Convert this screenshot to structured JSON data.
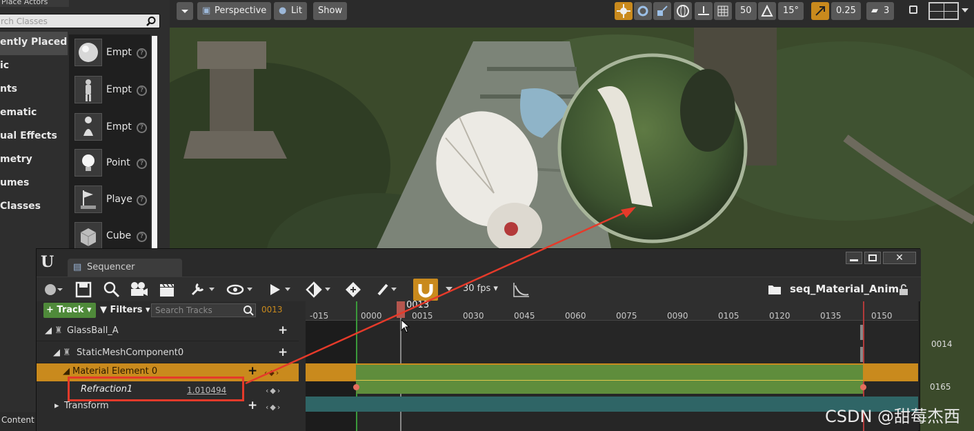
{
  "place_actors": {
    "title": "Place Actors",
    "search_placeholder": "rch Classes",
    "categories": [
      "ently Placed",
      "ic",
      "nts",
      "ematic",
      "ual Effects",
      "metry",
      "umes",
      "Classes"
    ],
    "items": [
      "Empt",
      "Empt",
      "Empt",
      "Point",
      "Playe",
      "Cube"
    ],
    "content_tab": "Content"
  },
  "viewport_toolbar": {
    "perspective": "Perspective",
    "lit": "Lit",
    "show": "Show",
    "grid_snap": "50",
    "rotate_snap": "15°",
    "scale_snap": "0.25",
    "camera_speed": "3"
  },
  "sequencer": {
    "tab_title": "Sequencer",
    "framerate": "30 fps",
    "sequence_name": "seq_Material_Anim",
    "add_track": "Track",
    "filters": "Filters",
    "search_placeholder": "Search Tracks",
    "current_frame": "0013",
    "frame_field": "0013",
    "tracks": [
      {
        "label": "GlassBall_A"
      },
      {
        "label": "StaticMeshComponent0"
      },
      {
        "label": "Material Element 0"
      },
      {
        "label": "Refraction1",
        "value": "1.010494"
      },
      {
        "label": "Transform"
      }
    ],
    "ruler_labels": [
      "-015",
      "0000",
      "0015",
      "0030",
      "0045",
      "0060",
      "0075",
      "0090",
      "0105",
      "0120",
      "0135",
      "0150"
    ],
    "side_numbers": [
      "0014",
      "0165"
    ]
  },
  "colors": {
    "accent_orange": "#c98a1d",
    "highlight_red": "#e53a2a",
    "track_green": "#5f8d3c",
    "track_teal": "#2f6566",
    "panel_bg": "#2b2b2b"
  },
  "watermark": "CSDN @甜莓杰西"
}
